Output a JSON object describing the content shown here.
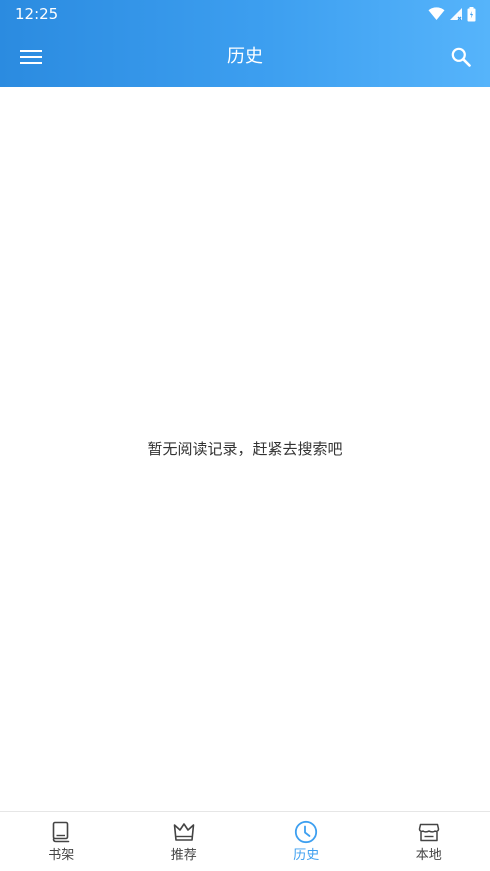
{
  "status_bar": {
    "time": "12:25"
  },
  "toolbar": {
    "title": "历史",
    "menu_icon": "hamburger-menu-icon",
    "search_icon": "search-icon"
  },
  "content": {
    "empty_message": "暂无阅读记录，赶紧去搜索吧"
  },
  "bottom_nav": {
    "items": [
      {
        "label": "书架",
        "icon": "book-icon",
        "active": false
      },
      {
        "label": "推荐",
        "icon": "crown-icon",
        "active": false
      },
      {
        "label": "历史",
        "icon": "clock-icon",
        "active": true
      },
      {
        "label": "本地",
        "icon": "store-icon",
        "active": false
      }
    ]
  },
  "colors": {
    "primary": "#3d9ff0",
    "primary_dark": "#2b8be0",
    "primary_light": "#56b4fb",
    "inactive": "#444444",
    "text": "#333333"
  }
}
